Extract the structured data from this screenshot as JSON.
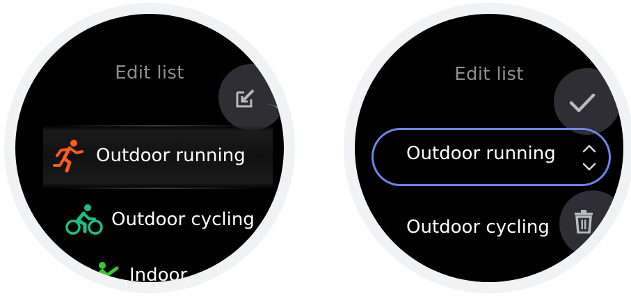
{
  "screens": {
    "left": {
      "title": "Edit list",
      "edit_icon": "edit-icon",
      "items": [
        {
          "label": "Outdoor running",
          "icon": "running-icon",
          "icon_color": "#ff5a1f"
        },
        {
          "label": "Outdoor cycling",
          "icon": "cycling-icon",
          "icon_color": "#19c08a"
        },
        {
          "label": "Indoor",
          "icon": "indoor-workout-icon",
          "icon_color": "#33cc33"
        }
      ]
    },
    "right": {
      "title": "Edit list",
      "confirm_icon": "check-icon",
      "delete_icon": "trash-icon",
      "selected_item": {
        "label": "Outdoor running",
        "accent": "#6f86e8"
      },
      "next_item": {
        "label": "Outdoor cycling"
      }
    }
  }
}
